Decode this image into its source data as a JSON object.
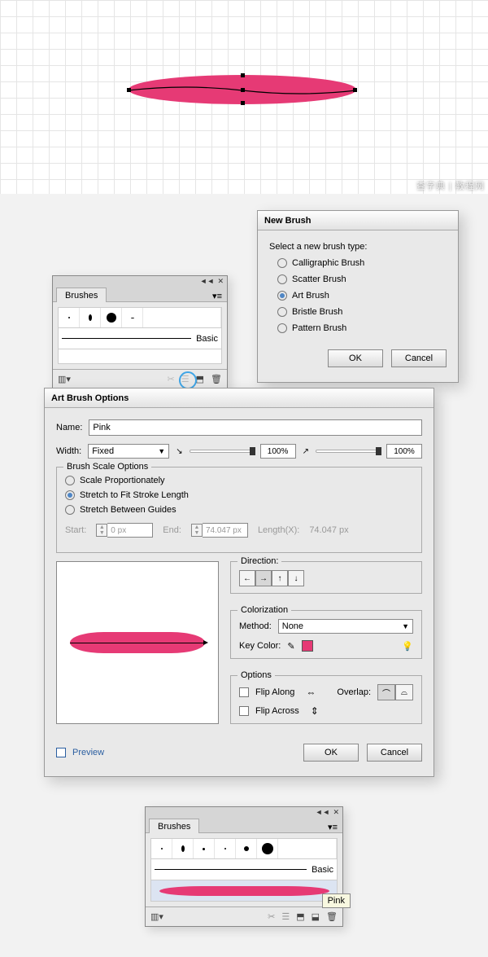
{
  "newBrush": {
    "title": "New Brush",
    "prompt": "Select a new brush type:",
    "options": [
      {
        "label": "Calligraphic Brush",
        "checked": false
      },
      {
        "label": "Scatter Brush",
        "checked": false
      },
      {
        "label": "Art Brush",
        "checked": true
      },
      {
        "label": "Bristle Brush",
        "checked": false
      },
      {
        "label": "Pattern Brush",
        "checked": false
      }
    ],
    "ok": "OK",
    "cancel": "Cancel"
  },
  "brushesPanel": {
    "title": "Brushes",
    "basicLabel": "Basic"
  },
  "brushesPanel2": {
    "title": "Brushes",
    "basicLabel": "Basic",
    "tooltip": "Pink"
  },
  "artBrush": {
    "title": "Art Brush Options",
    "nameLabel": "Name:",
    "nameValue": "Pink",
    "widthLabel": "Width:",
    "widthSelect": "Fixed",
    "pct1": "100%",
    "pct2": "100%",
    "scale": {
      "legend": "Brush Scale Options",
      "opts": [
        {
          "label": "Scale Proportionately",
          "checked": false
        },
        {
          "label": "Stretch to Fit Stroke Length",
          "checked": true
        },
        {
          "label": "Stretch Between Guides",
          "checked": false
        }
      ],
      "startLabel": "Start:",
      "startVal": "0 px",
      "endLabel": "End:",
      "endVal": "74.047 px",
      "lenLabel": "Length(X):",
      "lenVal": "74.047 px"
    },
    "direction": {
      "legend": "Direction:"
    },
    "color": {
      "legend": "Colorization",
      "methodLabel": "Method:",
      "methodValue": "None",
      "keyColorLabel": "Key Color:"
    },
    "options": {
      "legend": "Options",
      "flipAlong": "Flip Along",
      "flipAcross": "Flip Across",
      "overlapLabel": "Overlap:"
    },
    "preview": "Preview",
    "ok": "OK",
    "cancel": "Cancel"
  },
  "watermark": "查字典 | 教程网"
}
